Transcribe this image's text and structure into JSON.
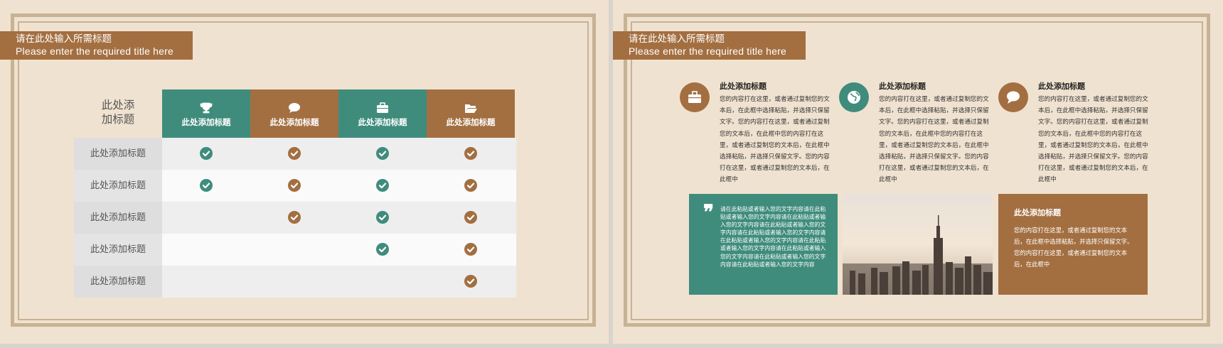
{
  "slides": {
    "left": {
      "title_cn": "请在此处输入所需标题",
      "title_en": "Please enter the required title here",
      "table": {
        "corner": "此处添加标题",
        "corner_line1": "此处添",
        "corner_line2": "加标题",
        "columns": [
          {
            "label": "此处添加标题",
            "icon": "trophy-icon",
            "color": "#3f8c7d"
          },
          {
            "label": "此处添加标题",
            "icon": "speech-bubble-icon",
            "color": "#a36f41"
          },
          {
            "label": "此处添加标题",
            "icon": "briefcase-icon",
            "color": "#3f8c7d"
          },
          {
            "label": "此处添加标题",
            "icon": "folder-open-icon",
            "color": "#a36f41"
          }
        ],
        "rows": [
          {
            "label": "此处添加标题",
            "checks": [
              true,
              true,
              true,
              true
            ]
          },
          {
            "label": "此处添加标题",
            "checks": [
              true,
              true,
              true,
              true
            ]
          },
          {
            "label": "此处添加标题",
            "checks": [
              false,
              true,
              true,
              true
            ]
          },
          {
            "label": "此处添加标题",
            "checks": [
              false,
              false,
              true,
              true
            ]
          },
          {
            "label": "此处添加标题",
            "checks": [
              false,
              false,
              false,
              true
            ]
          }
        ]
      }
    },
    "right": {
      "title_cn": "请在此处输入所需标题",
      "title_en": "Please enter the required title here",
      "features": [
        {
          "icon": "briefcase-icon",
          "color": "#a36f41",
          "title": "此处添加标题",
          "text": "您的内容打在这里，或者通过复制您的文本后，在此框中选择粘贴，并选择只保留文字。您的内容打在这里，或者通过复制您的文本后，在此框中您的内容打在这里，或者通过复制您的文本后，在此框中选择粘贴，并选择只保留文字。您的内容打在这里，或者通过复制您的文本后，在此框中"
        },
        {
          "icon": "globe-icon",
          "color": "#3f8c7d",
          "title": "此处添加标题",
          "text": "您的内容打在这里，或者通过复制您的文本后，在此框中选择粘贴，并选择只保留文字。您的内容打在这里，或者通过复制您的文本后，在此框中您的内容打在这里，或者通过复制您的文本后，在此框中选择粘贴，并选择只保留文字。您的内容打在这里，或者通过复制您的文本后，在此框中"
        },
        {
          "icon": "speech-bubble-icon",
          "color": "#a36f41",
          "title": "此处添加标题",
          "text": "您的内容打在这里，或者通过复制您的文本后，在此框中选择粘贴，并选择只保留文字。您的内容打在这里，或者通过复制您的文本后，在此框中您的内容打在这里，或者通过复制您的文本后，在此框中选择粘贴，并选择只保留文字。您的内容打在这里，或者通过复制您的文本后，在此框中"
        }
      ],
      "quote": {
        "mark": "❞",
        "text": "请在此粘贴或者输入您的文字内容请在此粘贴或者输入您的文字内容请在此粘贴或者输入您的文字内容请在此粘贴或者输入您的文字内容请在此粘贴或者输入您的文字内容请在此粘贴或者输入您的文字内容请在此粘贴或者输入您的文字内容请在此粘贴或者输入您的文字内容请在此粘贴或者输入您的文字内容请在此粘贴或者输入您的文字内容"
      },
      "info_box": {
        "title": "此处添加标题",
        "text": "您的内容打在这里，或者通过复制您的文本后，在此框中选择粘贴，并选择只保留文字。您的内容打在这里，或者通过复制您的文本后，在此框中"
      }
    }
  },
  "colors": {
    "teal": "#3f8c7d",
    "brown": "#a36f41",
    "background": "#f0e2d0",
    "frame": "#c8b294"
  }
}
